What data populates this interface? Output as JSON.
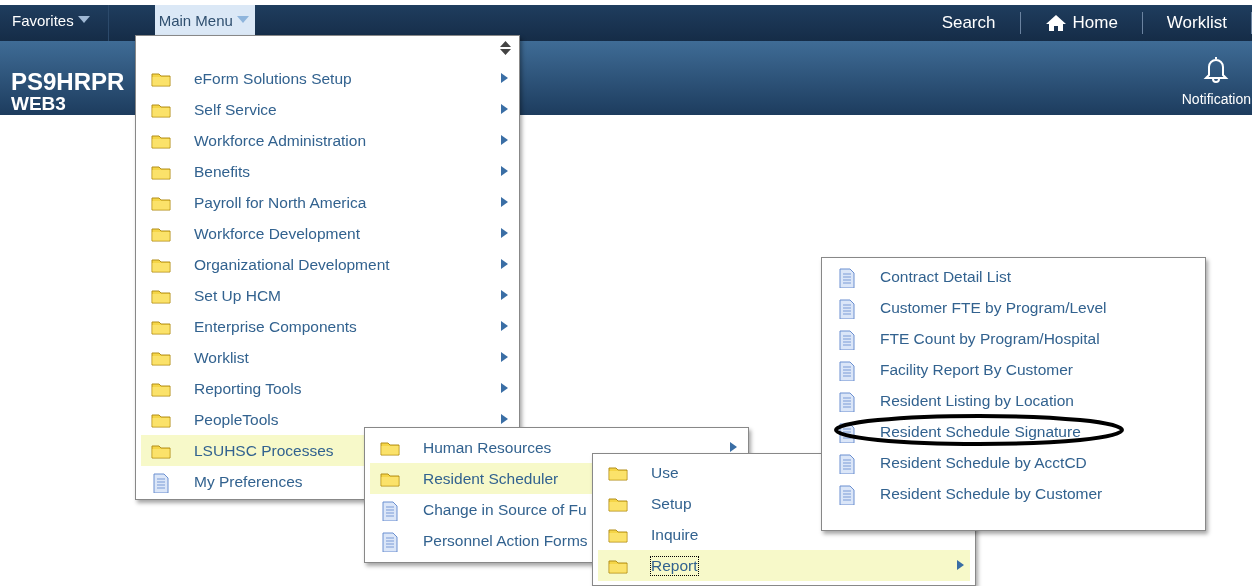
{
  "navbar": {
    "left": [
      {
        "label": "Favorites",
        "open": false
      },
      {
        "label": "Main Menu",
        "open": true
      }
    ],
    "right": [
      {
        "label": "Search",
        "kind": "text"
      },
      {
        "label": "Home",
        "kind": "home"
      },
      {
        "label": "Worklist",
        "kind": "text"
      }
    ]
  },
  "banner": {
    "title": "PS9HRPR",
    "subtitle": "WEB3",
    "notification": "Notification"
  },
  "menus": [
    {
      "items": [
        {
          "label": "eForm Solutions Setup",
          "kind": "folder",
          "submenu": true,
          "selected": false
        },
        {
          "label": "Self Service",
          "kind": "folder",
          "submenu": true,
          "selected": false
        },
        {
          "label": "Workforce Administration",
          "kind": "folder",
          "submenu": true,
          "selected": false
        },
        {
          "label": "Benefits",
          "kind": "folder",
          "submenu": true,
          "selected": false
        },
        {
          "label": "Payroll for North America",
          "kind": "folder",
          "submenu": true,
          "selected": false
        },
        {
          "label": "Workforce Development",
          "kind": "folder",
          "submenu": true,
          "selected": false
        },
        {
          "label": "Organizational Development",
          "kind": "folder",
          "submenu": true,
          "selected": false
        },
        {
          "label": "Set Up HCM",
          "kind": "folder",
          "submenu": true,
          "selected": false
        },
        {
          "label": "Enterprise Components",
          "kind": "folder",
          "submenu": true,
          "selected": false
        },
        {
          "label": "Worklist",
          "kind": "folder",
          "submenu": true,
          "selected": false
        },
        {
          "label": "Reporting Tools",
          "kind": "folder",
          "submenu": true,
          "selected": false
        },
        {
          "label": "PeopleTools",
          "kind": "folder",
          "submenu": true,
          "selected": false
        },
        {
          "label": "LSUHSC Processes",
          "kind": "folder",
          "submenu": false,
          "selected": true
        },
        {
          "label": "My Preferences",
          "kind": "page",
          "submenu": false,
          "selected": false
        }
      ]
    },
    {
      "items": [
        {
          "label": "Human Resources",
          "kind": "folder",
          "submenu": true,
          "selected": false
        },
        {
          "label": "Resident Scheduler",
          "kind": "folder",
          "submenu": false,
          "selected": true
        },
        {
          "label": "Change in Source of Fu",
          "kind": "page",
          "submenu": false,
          "selected": false
        },
        {
          "label": "Personnel Action Forms",
          "kind": "page",
          "submenu": false,
          "selected": false
        }
      ]
    },
    {
      "items": [
        {
          "label": "Use",
          "kind": "folder",
          "submenu": false,
          "selected": false,
          "focused": false
        },
        {
          "label": "Setup",
          "kind": "folder",
          "submenu": false,
          "selected": false,
          "focused": false
        },
        {
          "label": "Inquire",
          "kind": "folder",
          "submenu": false,
          "selected": false,
          "focused": false
        },
        {
          "label": "Report",
          "kind": "folder",
          "submenu": true,
          "selected": true,
          "focused": true
        }
      ]
    },
    {
      "items": [
        {
          "label": "Contract Detail List",
          "kind": "page",
          "submenu": false,
          "selected": false,
          "circled": false
        },
        {
          "label": "Customer FTE by Program/Level",
          "kind": "page",
          "submenu": false,
          "selected": false,
          "circled": false
        },
        {
          "label": "FTE Count by Program/Hospital",
          "kind": "page",
          "submenu": false,
          "selected": false,
          "circled": false
        },
        {
          "label": "Facility Report By Customer",
          "kind": "page",
          "submenu": false,
          "selected": false,
          "circled": false
        },
        {
          "label": "Resident Listing by Location",
          "kind": "page",
          "submenu": false,
          "selected": false,
          "circled": false
        },
        {
          "label": "Resident Schedule Signature",
          "kind": "page",
          "submenu": false,
          "selected": false,
          "circled": true
        },
        {
          "label": "Resident Schedule by AcctCD",
          "kind": "page",
          "submenu": false,
          "selected": false,
          "circled": false
        },
        {
          "label": "Resident Schedule by Customer",
          "kind": "page",
          "submenu": false,
          "selected": false,
          "circled": false
        }
      ]
    }
  ]
}
